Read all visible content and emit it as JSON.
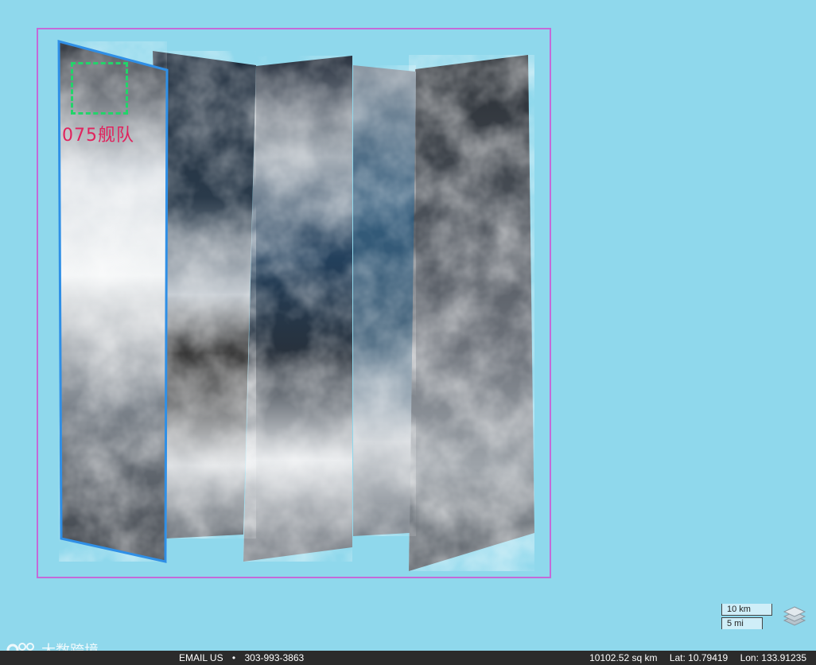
{
  "map": {
    "background_color": "#8fd8ec",
    "aoi_border_color": "#c46ad8",
    "selected_strip_border_color": "#2f8fe6",
    "target_box_color": "#22d46a",
    "target_label": "075舰队",
    "target_label_color": "#e0245e",
    "imagery_strip_count": 5,
    "selected_strip_index": 1
  },
  "scale_bar": {
    "km_label": "10 km",
    "mi_label": "5 mi"
  },
  "layers_button": {
    "icon": "layers-icon"
  },
  "watermark": {
    "text": "大数跨境"
  },
  "footer": {
    "email_label": "EMAIL US",
    "separator": "•",
    "phone": "303-993-3863",
    "area": "10102.52 sq km",
    "lat": "Lat: 10.79419",
    "lon": "Lon: 133.91235"
  }
}
